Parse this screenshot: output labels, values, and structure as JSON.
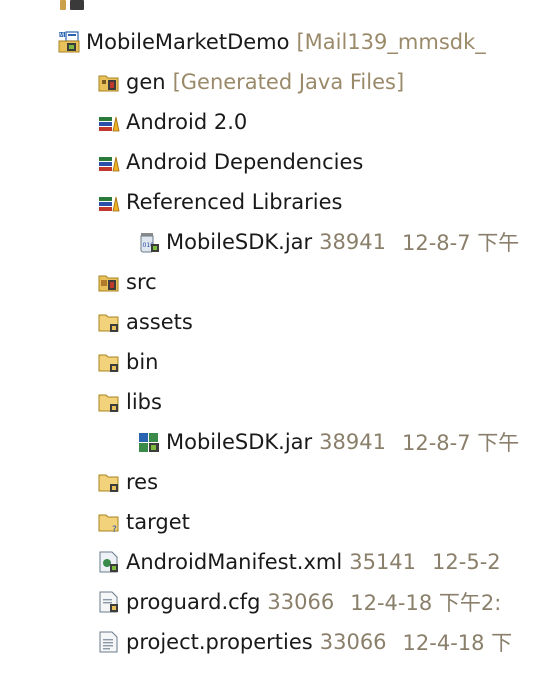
{
  "project": {
    "name": "MobileMarketDemo",
    "decoration": "[Mail139_mmsdk_"
  },
  "tree": {
    "gen": {
      "label": "gen",
      "decoration": "[Generated Java Files]"
    },
    "android20": {
      "label": "Android 2.0"
    },
    "android_deps": {
      "label": "Android Dependencies"
    },
    "ref_libs": {
      "label": "Referenced Libraries"
    },
    "ref_jar": {
      "label": "MobileSDK.jar",
      "size": "38941",
      "date": "12-8-7 下午"
    },
    "src": {
      "label": "src"
    },
    "assets": {
      "label": "assets"
    },
    "bin": {
      "label": "bin"
    },
    "libs": {
      "label": "libs"
    },
    "libs_jar": {
      "label": "MobileSDK.jar",
      "size": "38941",
      "date": "12-8-7 下午"
    },
    "res": {
      "label": "res"
    },
    "target": {
      "label": "target"
    },
    "manifest": {
      "label": "AndroidManifest.xml",
      "size": "35141",
      "date": "12-5-2"
    },
    "proguard": {
      "label": "proguard.cfg",
      "size": "33066",
      "date": "12-4-18 下午2:"
    },
    "props": {
      "label": "project.properties",
      "size": "33066",
      "date": "12-4-18 下"
    }
  },
  "icons": {
    "project": "android-project-icon",
    "gen": "source-folder-generated-icon",
    "library": "library-container-icon",
    "jar": "jar-file-icon",
    "src": "source-folder-icon",
    "folder": "folder-icon",
    "file_xml": "xml-file-icon",
    "file_text": "text-file-icon"
  },
  "colors": {
    "decoration": "#9a8a6a",
    "text": "#1a1a1a",
    "folder": "#e8c15a"
  }
}
